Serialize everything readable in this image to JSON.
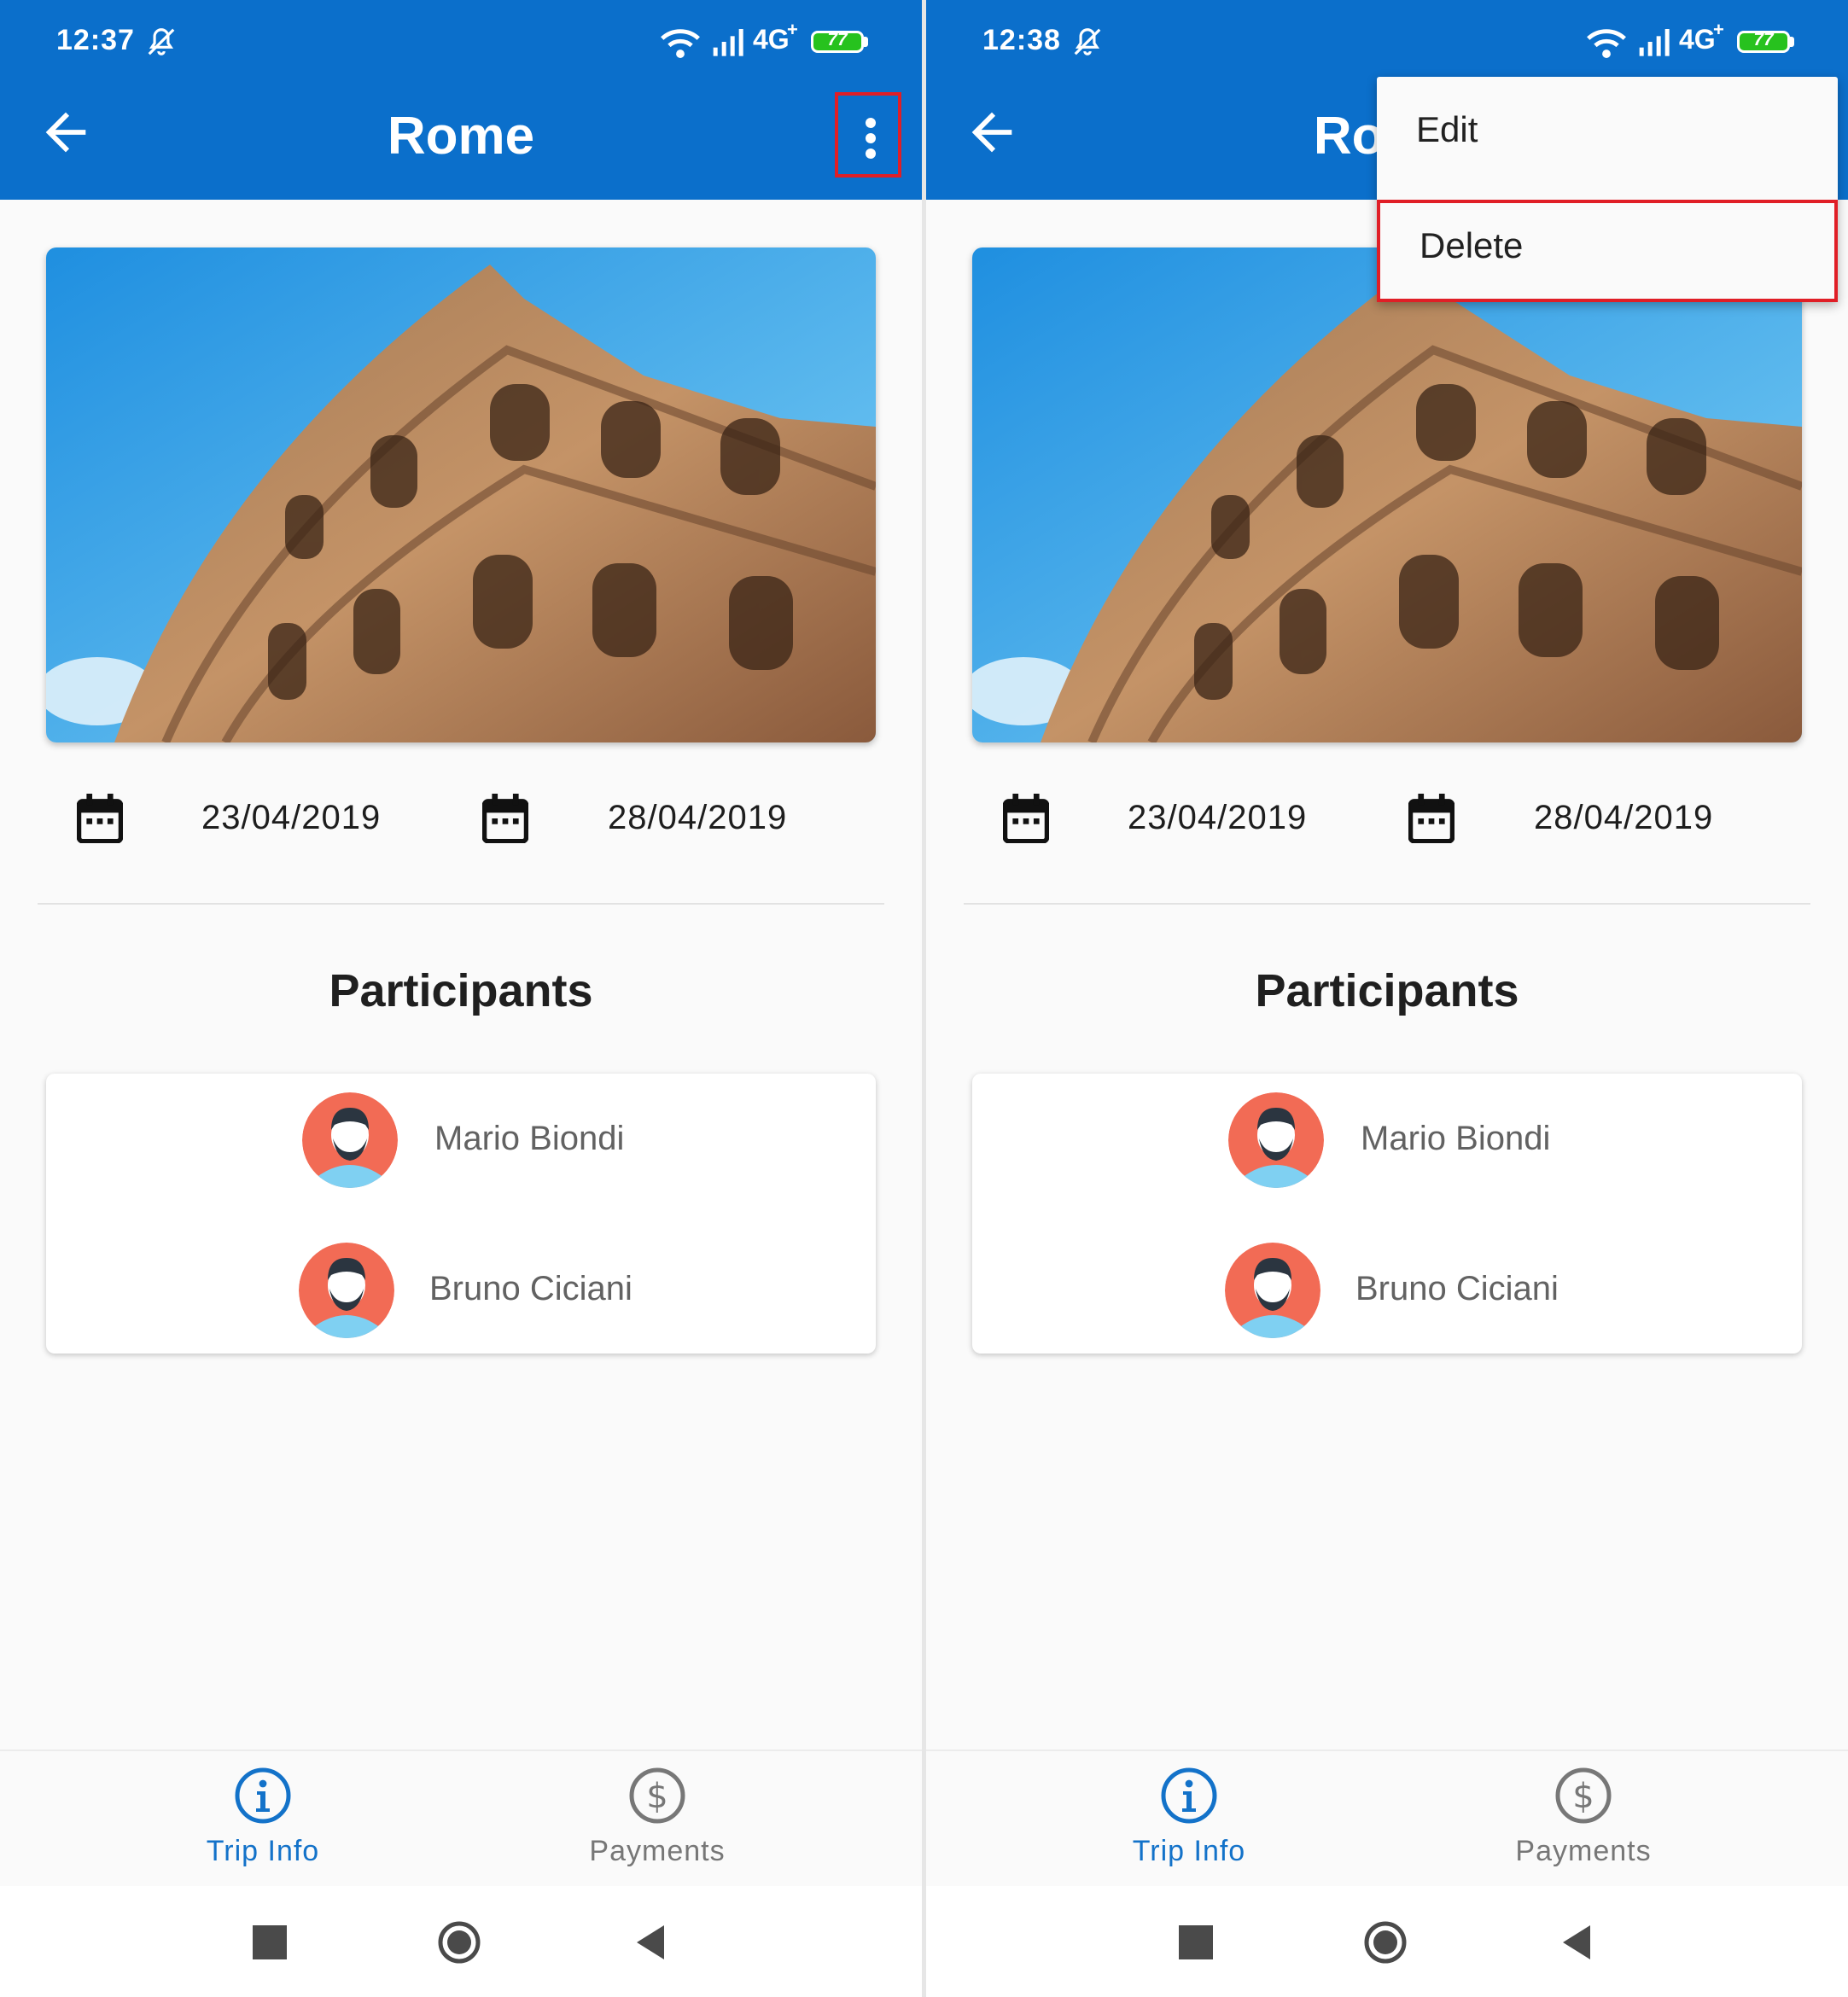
{
  "screens": [
    {
      "status": {
        "time": "12:37",
        "network": "4G",
        "network_plus": "+",
        "battery": "77"
      },
      "appbar": {
        "title": "Rome"
      },
      "trip": {
        "start_date": "23/04/2019",
        "end_date": "28/04/2019"
      },
      "participants": {
        "heading": "Participants",
        "people": [
          {
            "name": "Mario Biondi"
          },
          {
            "name": "Bruno Ciciani"
          }
        ]
      },
      "nav": {
        "trip_info": "Trip Info",
        "payments": "Payments"
      }
    },
    {
      "status": {
        "time": "12:38",
        "network": "4G",
        "network_plus": "+",
        "battery": "77"
      },
      "appbar": {
        "title": "Rome"
      },
      "trip": {
        "start_date": "23/04/2019",
        "end_date": "28/04/2019"
      },
      "participants": {
        "heading": "Participants",
        "people": [
          {
            "name": "Mario Biondi"
          },
          {
            "name": "Bruno Ciciani"
          }
        ]
      },
      "nav": {
        "trip_info": "Trip Info",
        "payments": "Payments"
      },
      "menu": {
        "items": [
          {
            "label": "Edit"
          },
          {
            "label": "Delete"
          }
        ]
      }
    }
  ],
  "theme": {
    "primary": "#0b6fcb",
    "active_nav": "#1372c9",
    "highlight": "#e01e26",
    "avatar_bg": "#f26b55"
  },
  "icons": [
    "back-arrow-icon",
    "more-vert-icon",
    "calendar-icon",
    "info-icon",
    "dollar-icon",
    "square-icon",
    "circle-icon",
    "triangle-back-icon",
    "wifi-icon",
    "signal-icon",
    "mute-icon",
    "battery-icon"
  ]
}
